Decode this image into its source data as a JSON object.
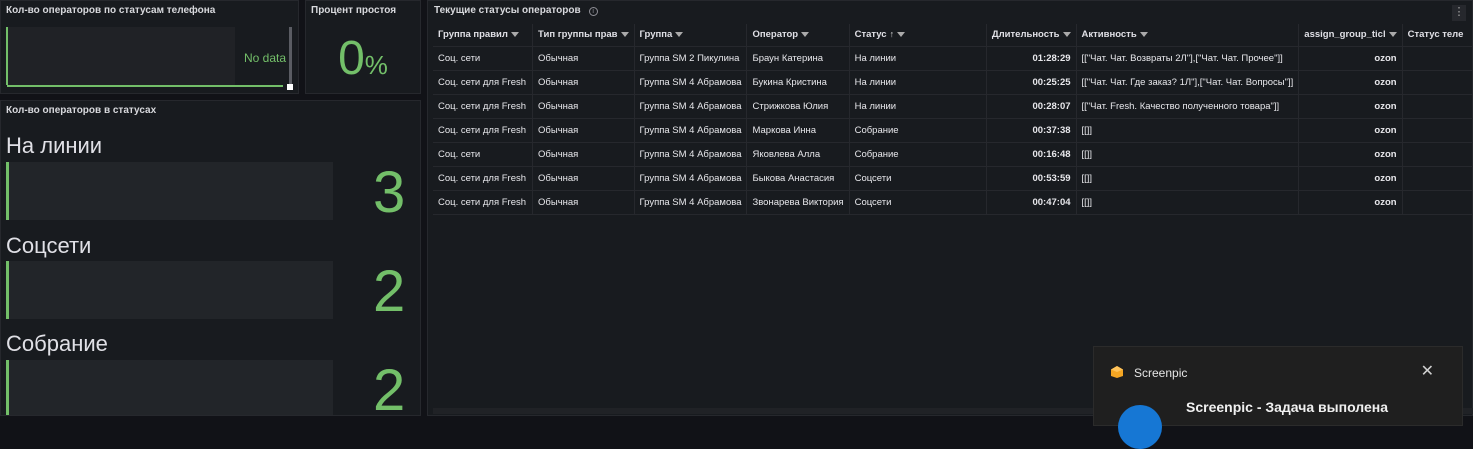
{
  "panels": {
    "phone_status": {
      "title": "Кол-во операторов по статусам телефона",
      "nodata": "No data"
    },
    "idle_percent": {
      "title": "Процент простоя",
      "value": "0",
      "unit": "%"
    },
    "status_counts": {
      "title": "Кол-во операторов в статусах",
      "items": [
        {
          "label": "На линии",
          "value": "3"
        },
        {
          "label": "Соцсети",
          "value": "2"
        },
        {
          "label": "Собрание",
          "value": "2"
        }
      ]
    },
    "current_statuses": {
      "title": "Текущие статусы операторов",
      "info_icon": "i",
      "menu_icon": "⋮"
    }
  },
  "table": {
    "columns": [
      "Группа правил",
      "Тип группы прав",
      "Группа",
      "Оператор",
      "Статус",
      "Длительность",
      "Активность",
      "assign_group_ticl",
      "Статус теле"
    ],
    "sort_indicator": "↑",
    "rows": [
      [
        "Соц. сети",
        "Обычная",
        "Группа SM 2 Пикулина",
        "Браун Катерина",
        "На линии",
        "01:28:29",
        "[[\"Чат. Чат. Возвраты 2Л\"],[\"Чат. Чат. Прочее\"]]",
        "ozon",
        ""
      ],
      [
        "Соц. сети для Fresh",
        "Обычная",
        "Группа SM 4 Абрамова",
        "Букина Кристина",
        "На линии",
        "00:25:25",
        "[[\"Чат. Чат. Где заказ? 1Л\"],[\"Чат. Чат. Вопросы\"]]",
        "ozon",
        ""
      ],
      [
        "Соц. сети для Fresh",
        "Обычная",
        "Группа SM 4 Абрамова",
        "Стрижкова Юлия",
        "На линии",
        "00:28:07",
        "[[\"Чат. Fresh. Качество полученного товара\"]]",
        "ozon",
        ""
      ],
      [
        "Соц. сети для Fresh",
        "Обычная",
        "Группа SM 4 Абрамова",
        "Маркова Инна",
        "Собрание",
        "00:37:38",
        "[[]]",
        "ozon",
        ""
      ],
      [
        "Соц. сети",
        "Обычная",
        "Группа SM 4 Абрамова",
        "Яковлева Алла",
        "Собрание",
        "00:16:48",
        "[[]]",
        "ozon",
        ""
      ],
      [
        "Соц. сети для Fresh",
        "Обычная",
        "Группа SM 4 Абрамова",
        "Быкова Анастасия",
        "Соцсети",
        "00:53:59",
        "[[]]",
        "ozon",
        ""
      ],
      [
        "Соц. сети для Fresh",
        "Обычная",
        "Группа SM 4 Абрамова",
        "Звонарева Виктория",
        "Соцсети",
        "00:47:04",
        "[[]]",
        "ozon",
        ""
      ]
    ]
  },
  "toast": {
    "app_name": "Screenpic",
    "message": "Screenpic - Задача выполена",
    "close_icon": "✕"
  },
  "colors": {
    "accent_green": "#73bf69",
    "background": "#111217",
    "panel": "#181b1f",
    "toast_blue": "#1677d4",
    "logo_orange": "#f5a623"
  }
}
